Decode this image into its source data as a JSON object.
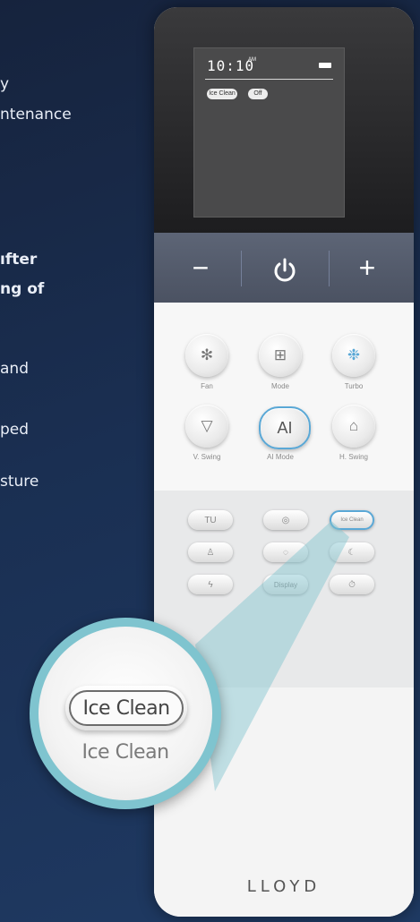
{
  "left_text": {
    "line1": "y",
    "line2": "ntenance",
    "line3": "ıfter",
    "line4": "ng of",
    "line5": "and",
    "line6": "ped",
    "line7": "sture"
  },
  "lcd": {
    "time": "10:10",
    "ampm": "AM",
    "mode_pill": "Ice Clean",
    "state_pill": "Off"
  },
  "control_bar": {
    "minus": "−",
    "power_icon": "power-icon",
    "plus": "+"
  },
  "top_buttons": [
    {
      "label": "Fan",
      "icon": "fan-icon"
    },
    {
      "label": "Mode",
      "icon": "grid-icon"
    },
    {
      "label": "Turbo",
      "icon": "turbo-icon"
    },
    {
      "label": "V. Swing",
      "icon": "v-swing-icon"
    },
    {
      "label": "AI Mode",
      "text": "AI"
    },
    {
      "label": "H. Swing",
      "icon": "h-swing-icon"
    }
  ],
  "pill_buttons": {
    "row1": [
      "TU",
      "",
      "Ice Clean"
    ],
    "row1_labels": [
      "",
      "",
      "Ice Clean"
    ],
    "row2_labels": [
      "Display",
      "Sleep"
    ],
    "display": "Display"
  },
  "callout": {
    "button_text": "Ice Clean",
    "label": "Ice Clean"
  },
  "brand": "LLOYD",
  "colors": {
    "accent": "#5aa8d6",
    "callout": "#7fc4cf",
    "background": "#1a2f52"
  }
}
